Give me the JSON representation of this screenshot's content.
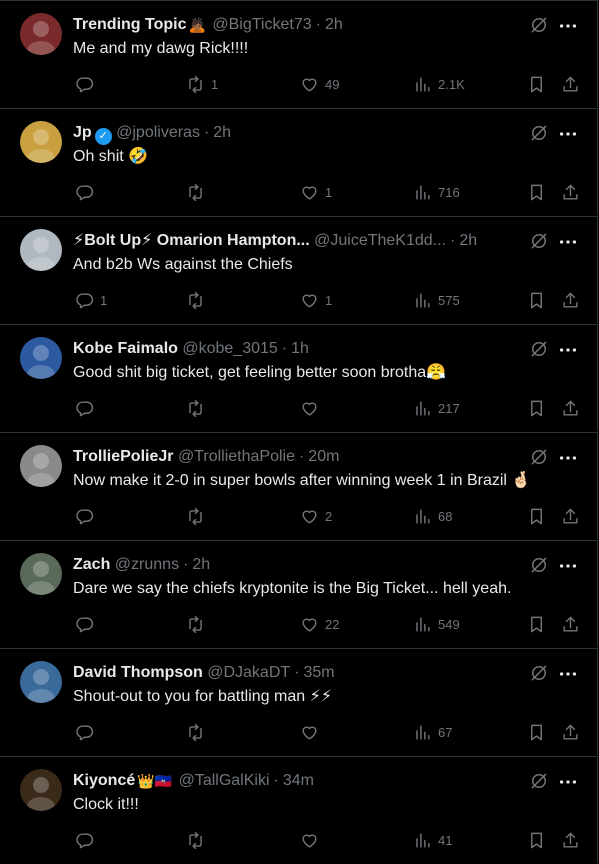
{
  "tweets": [
    {
      "name": "Trending Topic",
      "badge": "🙇🏾",
      "handle": "@BigTicket73",
      "time": "2h",
      "text": "Me and my dawg Rick!!!!",
      "replies": "",
      "reposts": "1",
      "likes": "49",
      "views": "2.1K",
      "avatar_color": "#7a2a2a"
    },
    {
      "name": "Jp",
      "verified": true,
      "handle": "@jpoliveras",
      "time": "2h",
      "text": "Oh shit 🤣",
      "replies": "",
      "reposts": "",
      "likes": "1",
      "views": "716",
      "avatar_color": "#c8a040"
    },
    {
      "name": "⚡Bolt Up⚡ Omarion Hampton...",
      "handle": "@JuiceTheK1dd...",
      "time": "2h",
      "text": "And b2b Ws against the Chiefs",
      "replies": "1",
      "reposts": "",
      "likes": "1",
      "views": "575",
      "avatar_color": "#b0b8c0"
    },
    {
      "name": "Kobe Faimalo",
      "handle": "@kobe_3015",
      "time": "1h",
      "text": "Good shit big ticket, get feeling better soon brotha😤",
      "replies": "",
      "reposts": "",
      "likes": "",
      "views": "217",
      "avatar_color": "#2c5aa0"
    },
    {
      "name": "TrolliePolieJr",
      "handle": "@TrolliethaPolie",
      "time": "20m",
      "text": "Now make it 2-0 in super bowls after winning week 1 in Brazil 🤞🏻",
      "replies": "",
      "reposts": "",
      "likes": "2",
      "views": "68",
      "avatar_color": "#8a8a8a"
    },
    {
      "name": "Zach",
      "handle": "@zrunns",
      "time": "2h",
      "text": "Dare we say the chiefs kryptonite is the Big Ticket... hell yeah.",
      "replies": "",
      "reposts": "",
      "likes": "22",
      "views": "549",
      "avatar_color": "#5a6a5a"
    },
    {
      "name": "David Thompson",
      "handle": "@DJakaDT",
      "time": "35m",
      "text": "Shout-out to you for battling man ⚡⚡",
      "replies": "",
      "reposts": "",
      "likes": "",
      "views": "67",
      "avatar_color": "#3a6a9a"
    },
    {
      "name": "Kiyoncé",
      "badge": "👑🇭🇹",
      "handle": "@TallGalKiki",
      "time": "34m",
      "text": "Clock it!!!",
      "replies": "",
      "reposts": "",
      "likes": "",
      "views": "41",
      "avatar_color": "#3a2a1a"
    }
  ],
  "separator": "·",
  "icons": {
    "reply": "reply-icon",
    "repost": "repost-icon",
    "like": "heart-icon",
    "views": "views-icon",
    "bookmark": "bookmark-icon",
    "share": "share-icon",
    "grok": "grok-icon",
    "more": "more-icon"
  }
}
